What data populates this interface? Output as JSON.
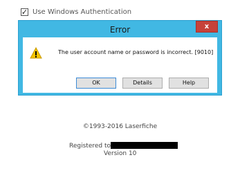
{
  "auth": {
    "checkbox_mark": "✓",
    "label": "Use Windows Authentication"
  },
  "dialog": {
    "title": "Error",
    "close_glyph": "x",
    "message": "The user account name or password is incorrect. [9010]",
    "buttons": {
      "ok": "OK",
      "details": "Details",
      "help": "Help"
    },
    "icon": "warning-icon"
  },
  "footer": {
    "copyright": "©1993-2016 Laserfiche",
    "registered_label": "Registered to:",
    "version": "Version 10"
  },
  "colors": {
    "title_bar": "#41b8e3",
    "close_button": "#c6423a",
    "warning_yellow": "#f5c400"
  }
}
